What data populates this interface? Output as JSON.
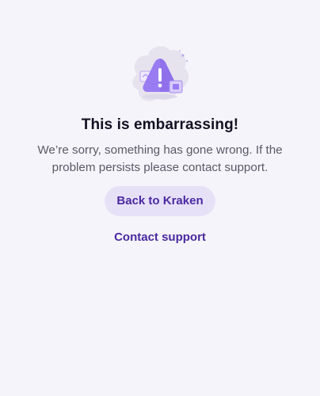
{
  "error_page": {
    "illustration_icon": "warning-triangle-illustration",
    "title": "This is embarrassing!",
    "message": "We’re sorry, something has gone wrong. If the problem persists please contact support.",
    "back_button_label": "Back to Kraken",
    "contact_link_label": "Contact support"
  },
  "colors": {
    "background": "#f5f4fa",
    "accent": "#4b2aa0",
    "button_bg": "#e7e1f8",
    "title": "#141022",
    "body_text": "#5b5966",
    "illustration_purple": "#9a7cf2"
  }
}
